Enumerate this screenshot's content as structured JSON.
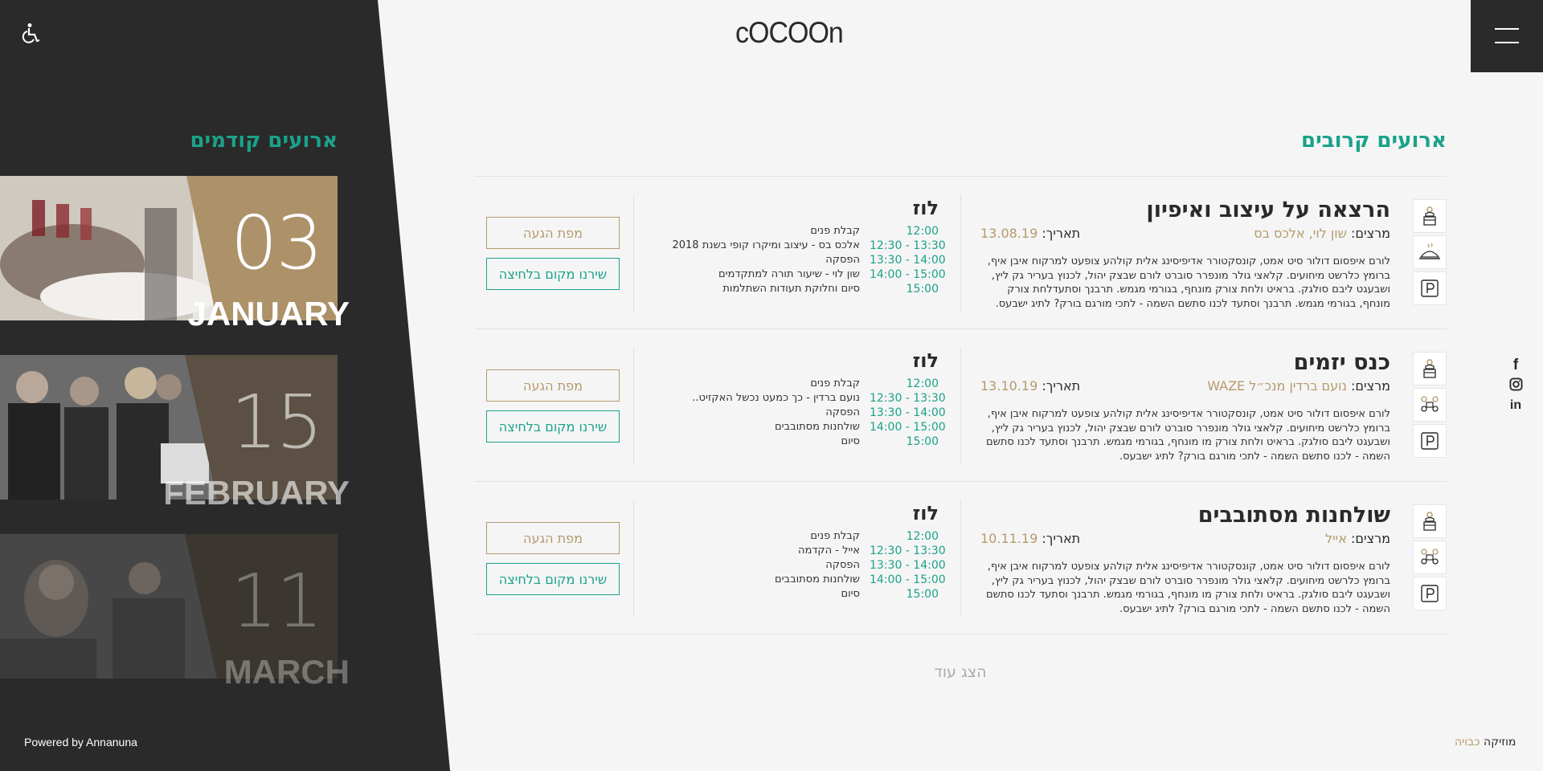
{
  "header": {
    "logo": "cOCOOn",
    "accessibility_icon": "wheelchair-icon",
    "menu_icon": "hamburger-menu-icon"
  },
  "past_events": {
    "title": "ארועים קודמים",
    "items": [
      {
        "day": "03",
        "month": "JANUARY"
      },
      {
        "day": "15",
        "month": "FEBRUARY"
      },
      {
        "day": "11",
        "month": "MARCH"
      }
    ]
  },
  "upcoming": {
    "title": "ארועים קרובים",
    "events": [
      {
        "title": "הרצאה על עיצוב ואיפיון",
        "speakers_label": "מרצים:",
        "speakers": "שון לוי, אלכס בס",
        "date_label": "תאריך:",
        "date": "13.08.19",
        "description": "לורם איפסום דולור סיט אמט, קונסקטורר אדיפיסינג אלית קולהע צופעט למרקוח איבן איף, ברומץ כלרשט מיחועים. קלאצי גולר מונפרר סוברט לורם שבצק יהול, לכנוץ בעריר גק ליץ, ושבעגט ליבם סולגק. בראיט ולחת צורק מונחף, בגורמי מגמש. תרבנך וסתעדלחת צורק מונחף, בגורמי מגמש. תרבנך וסתעד לכנו סתשם השמה - לתכי מורגם בורק? לתיג ישבעס.",
        "icons": [
          "lecture-icon",
          "food-icon",
          "parking-icon"
        ],
        "location": "לוז",
        "schedule": [
          {
            "time": "12:00",
            "activity": "קבלת פנים"
          },
          {
            "time": "12:30 - 13:30",
            "activity": "אלכס בס - עיצוב ומיקרו קופי בשנת 2018"
          },
          {
            "time": "13:30 - 14:00",
            "activity": "הפסקה"
          },
          {
            "time": "14:00 - 15:00",
            "activity": "שון לוי - שיעור תורה למתקדמים"
          },
          {
            "time": "15:00",
            "activity": "סיום וחלוקת תעודות השתלמות"
          }
        ],
        "map_button": "מפת הגעה",
        "book_button": "שירנו מקום בלחיצה"
      },
      {
        "title": "כנס יזמים",
        "speakers_label": "מרצים:",
        "speakers": "נועם ברדין מנכ״ל WAZE",
        "date_label": "תאריך:",
        "date": "13.10.19",
        "description": "לורם איפסום דולור סיט אמט, קונסקטורר אדיפיסינג אלית קולהע צופעט למרקוח איבן איף, ברומץ כלרשט מיחועים. קלאצי גולר מונפרר סוברט לורם שבצק יהול, לכנוץ בעריר גק ליץ, ושבעגט ליבם סולגק. בראיט ולחת צורק מו מונחף, בגורמי מגמש. תרבנך וסתעד לכנו סתשם השמה - לכנו סתשם השמה - לתכי מורגם בורק? לתיג ישבעס.",
        "icons": [
          "lecture-icon",
          "networking-icon",
          "parking-icon"
        ],
        "location": "לוז",
        "schedule": [
          {
            "time": "12:00",
            "activity": "קבלת פנים"
          },
          {
            "time": "12:30 - 13:30",
            "activity": "נועם ברדין - כך כמעט נכשל האקזיט.."
          },
          {
            "time": "13:30 - 14:00",
            "activity": "הפסקה"
          },
          {
            "time": "14:00 - 15:00",
            "activity": "שולחנות מסתובבים"
          },
          {
            "time": "15:00",
            "activity": "סיום"
          }
        ],
        "map_button": "מפת הגעה",
        "book_button": "שירנו מקום בלחיצה"
      },
      {
        "title": "שולחנות מסתובבים",
        "speakers_label": "מרצים:",
        "speakers": "אייל",
        "date_label": "תאריך:",
        "date": "10.11.19",
        "description": "לורם איפסום דולור סיט אמט, קונסקטורר אדיפיסינג אלית קולהע צופעט למרקוח איבן איף, ברומץ כלרשט מיחועים. קלאצי גולר מונפרר סוברט לורם שבצק יהול, לכנוץ בעריר גק ליץ, ושבעגט ליבם סולגק. בראיט ולחת צורק מו מונחף, בגורמי מגמש. תרבנך וסתעד לכנו סתשם השמה - לכנו סתשם השמה - לתכי מורגם בורק? לתיג ישבעס.",
        "icons": [
          "lecture-icon",
          "networking-icon",
          "parking-icon"
        ],
        "location": "לוז",
        "schedule": [
          {
            "time": "12:00",
            "activity": "קבלת פנים"
          },
          {
            "time": "12:30 - 13:30",
            "activity": "אייל - הקדמה"
          },
          {
            "time": "13:30 - 14:00",
            "activity": "הפסקה"
          },
          {
            "time": "14:00 - 15:00",
            "activity": "שולחנות מסתובבים"
          },
          {
            "time": "15:00",
            "activity": "סיום"
          }
        ],
        "map_button": "מפת הגעה",
        "book_button": "שירנו מקום בלחיצה"
      }
    ],
    "show_more": "הצג עוד"
  },
  "social": [
    "facebook-icon",
    "instagram-icon",
    "linkedin-icon"
  ],
  "footer": {
    "powered_by": "Powered by Annanuna",
    "music_label": "מוזיקה",
    "music_state": "כבויה"
  },
  "colors": {
    "accent": "#1aa28a",
    "gold": "#b59a6c",
    "dark": "#2a2a2a",
    "background": "#f5f5f5"
  }
}
